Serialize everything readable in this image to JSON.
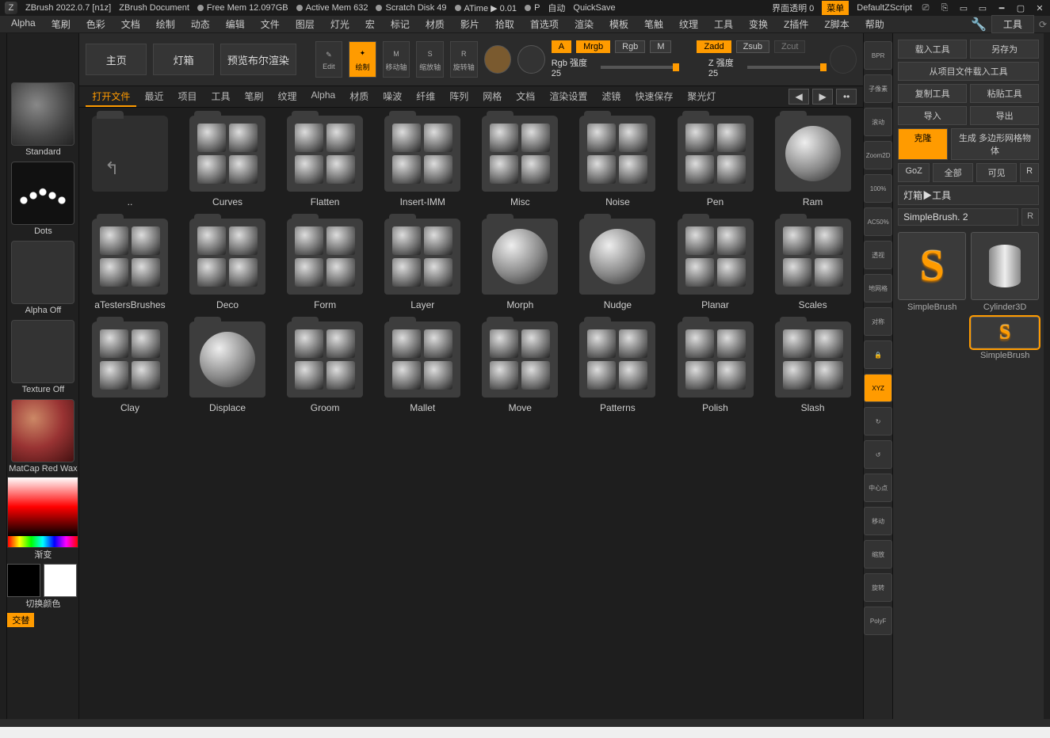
{
  "titlebar": {
    "app": "ZBrush 2022.0.7 [n1z]",
    "doc": "ZBrush Document",
    "freeMem": "Free Mem 12.097GB",
    "activeMem": "Active Mem 632",
    "scratch": "Scratch Disk 49",
    "atime": "ATime ▶ 0.01",
    "p": "P",
    "auto": "自动",
    "quicksave": "QuickSave",
    "transparency": "界面透明 0",
    "menu": "菜单",
    "defaultScript": "DefaultZScript"
  },
  "menus": [
    "Alpha",
    "笔刷",
    "色彩",
    "文档",
    "绘制",
    "动态",
    "编辑",
    "文件",
    "图层",
    "灯光",
    "宏",
    "标记",
    "材质",
    "影片",
    "拾取",
    "首选项",
    "渲染",
    "模板",
    "笔触",
    "纹理",
    "工具",
    "变换",
    "Z插件",
    "Z脚本",
    "帮助"
  ],
  "rightHeader": "工具",
  "top": {
    "home": "主页",
    "lightbox": "灯箱",
    "preview": "预览布尔渲染",
    "edit": "Edit",
    "draw": "绘制",
    "move": "移动轴",
    "scale": "缩放轴",
    "rotate": "旋转轴",
    "A": "A",
    "Mrgb": "Mrgb",
    "Rgb": "Rgb",
    "M": "M",
    "Zadd": "Zadd",
    "Zsub": "Zsub",
    "Zcut": "Zcut",
    "rgbIntensity": "Rgb 强度 25",
    "zIntensity": "Z 强度 25"
  },
  "left": {
    "brush": "Standard",
    "stroke": "Dots",
    "alpha": "Alpha Off",
    "texture": "Texture Off",
    "material": "MatCap Red Wax",
    "gradient": "渐变",
    "switch": "切换颜色",
    "alt": "交替"
  },
  "tabs": [
    "打开文件",
    "最近",
    "项目",
    "工具",
    "笔刷",
    "纹理",
    "Alpha",
    "材质",
    "噪波",
    "纤维",
    "阵列",
    "网格",
    "文档",
    "渲染设置",
    "滤镜",
    "快速保存",
    "聚光灯"
  ],
  "activeTab": 4,
  "folders": [
    {
      "label": "..",
      "type": "parent"
    },
    {
      "label": "Curves",
      "type": "grid"
    },
    {
      "label": "Flatten",
      "type": "grid"
    },
    {
      "label": "Insert-IMM",
      "type": "grid"
    },
    {
      "label": "Misc",
      "type": "grid"
    },
    {
      "label": "Noise",
      "type": "grid"
    },
    {
      "label": "Pen",
      "type": "grid"
    },
    {
      "label": "Ram",
      "type": "single"
    },
    {
      "label": "aTestersBrushes",
      "type": "grid"
    },
    {
      "label": "Deco",
      "type": "grid"
    },
    {
      "label": "Form",
      "type": "grid"
    },
    {
      "label": "Layer",
      "type": "grid"
    },
    {
      "label": "Morph",
      "type": "single"
    },
    {
      "label": "Nudge",
      "type": "single"
    },
    {
      "label": "Planar",
      "type": "grid"
    },
    {
      "label": "Scales",
      "type": "grid"
    },
    {
      "label": "Clay",
      "type": "grid"
    },
    {
      "label": "Displace",
      "type": "single"
    },
    {
      "label": "Groom",
      "type": "grid"
    },
    {
      "label": "Mallet",
      "type": "grid"
    },
    {
      "label": "Move",
      "type": "grid"
    },
    {
      "label": "Patterns",
      "type": "grid"
    },
    {
      "label": "Polish",
      "type": "grid"
    },
    {
      "label": "Slash",
      "type": "grid"
    }
  ],
  "rightStrip": [
    "BPR",
    "子像素",
    "滚动",
    "Zoom2D",
    "100%",
    "AC50%",
    "透视",
    "地网格",
    "对称",
    "🔒",
    "XYZ",
    "↻",
    "↺",
    "中心点",
    "移动",
    "缩放",
    "旋转",
    "PolyF"
  ],
  "rightPanel": {
    "loadTool": "载入工具",
    "saveAs": "另存为",
    "importFromFile": "从项目文件载入工具",
    "copyTool": "复制工具",
    "pasteTool": "粘贴工具",
    "import": "导入",
    "export": "导出",
    "clone": "克隆",
    "makePolymesh": "生成 多边形网格物体",
    "goz": "GoZ",
    "all": "全部",
    "visible": "可见",
    "R": "R",
    "lightboxTools": "灯箱▶工具",
    "toolName": "SimpleBrush. 2",
    "tool1": "SimpleBrush",
    "tool2": "Cylinder3D",
    "tool3": "SimpleBrush"
  }
}
